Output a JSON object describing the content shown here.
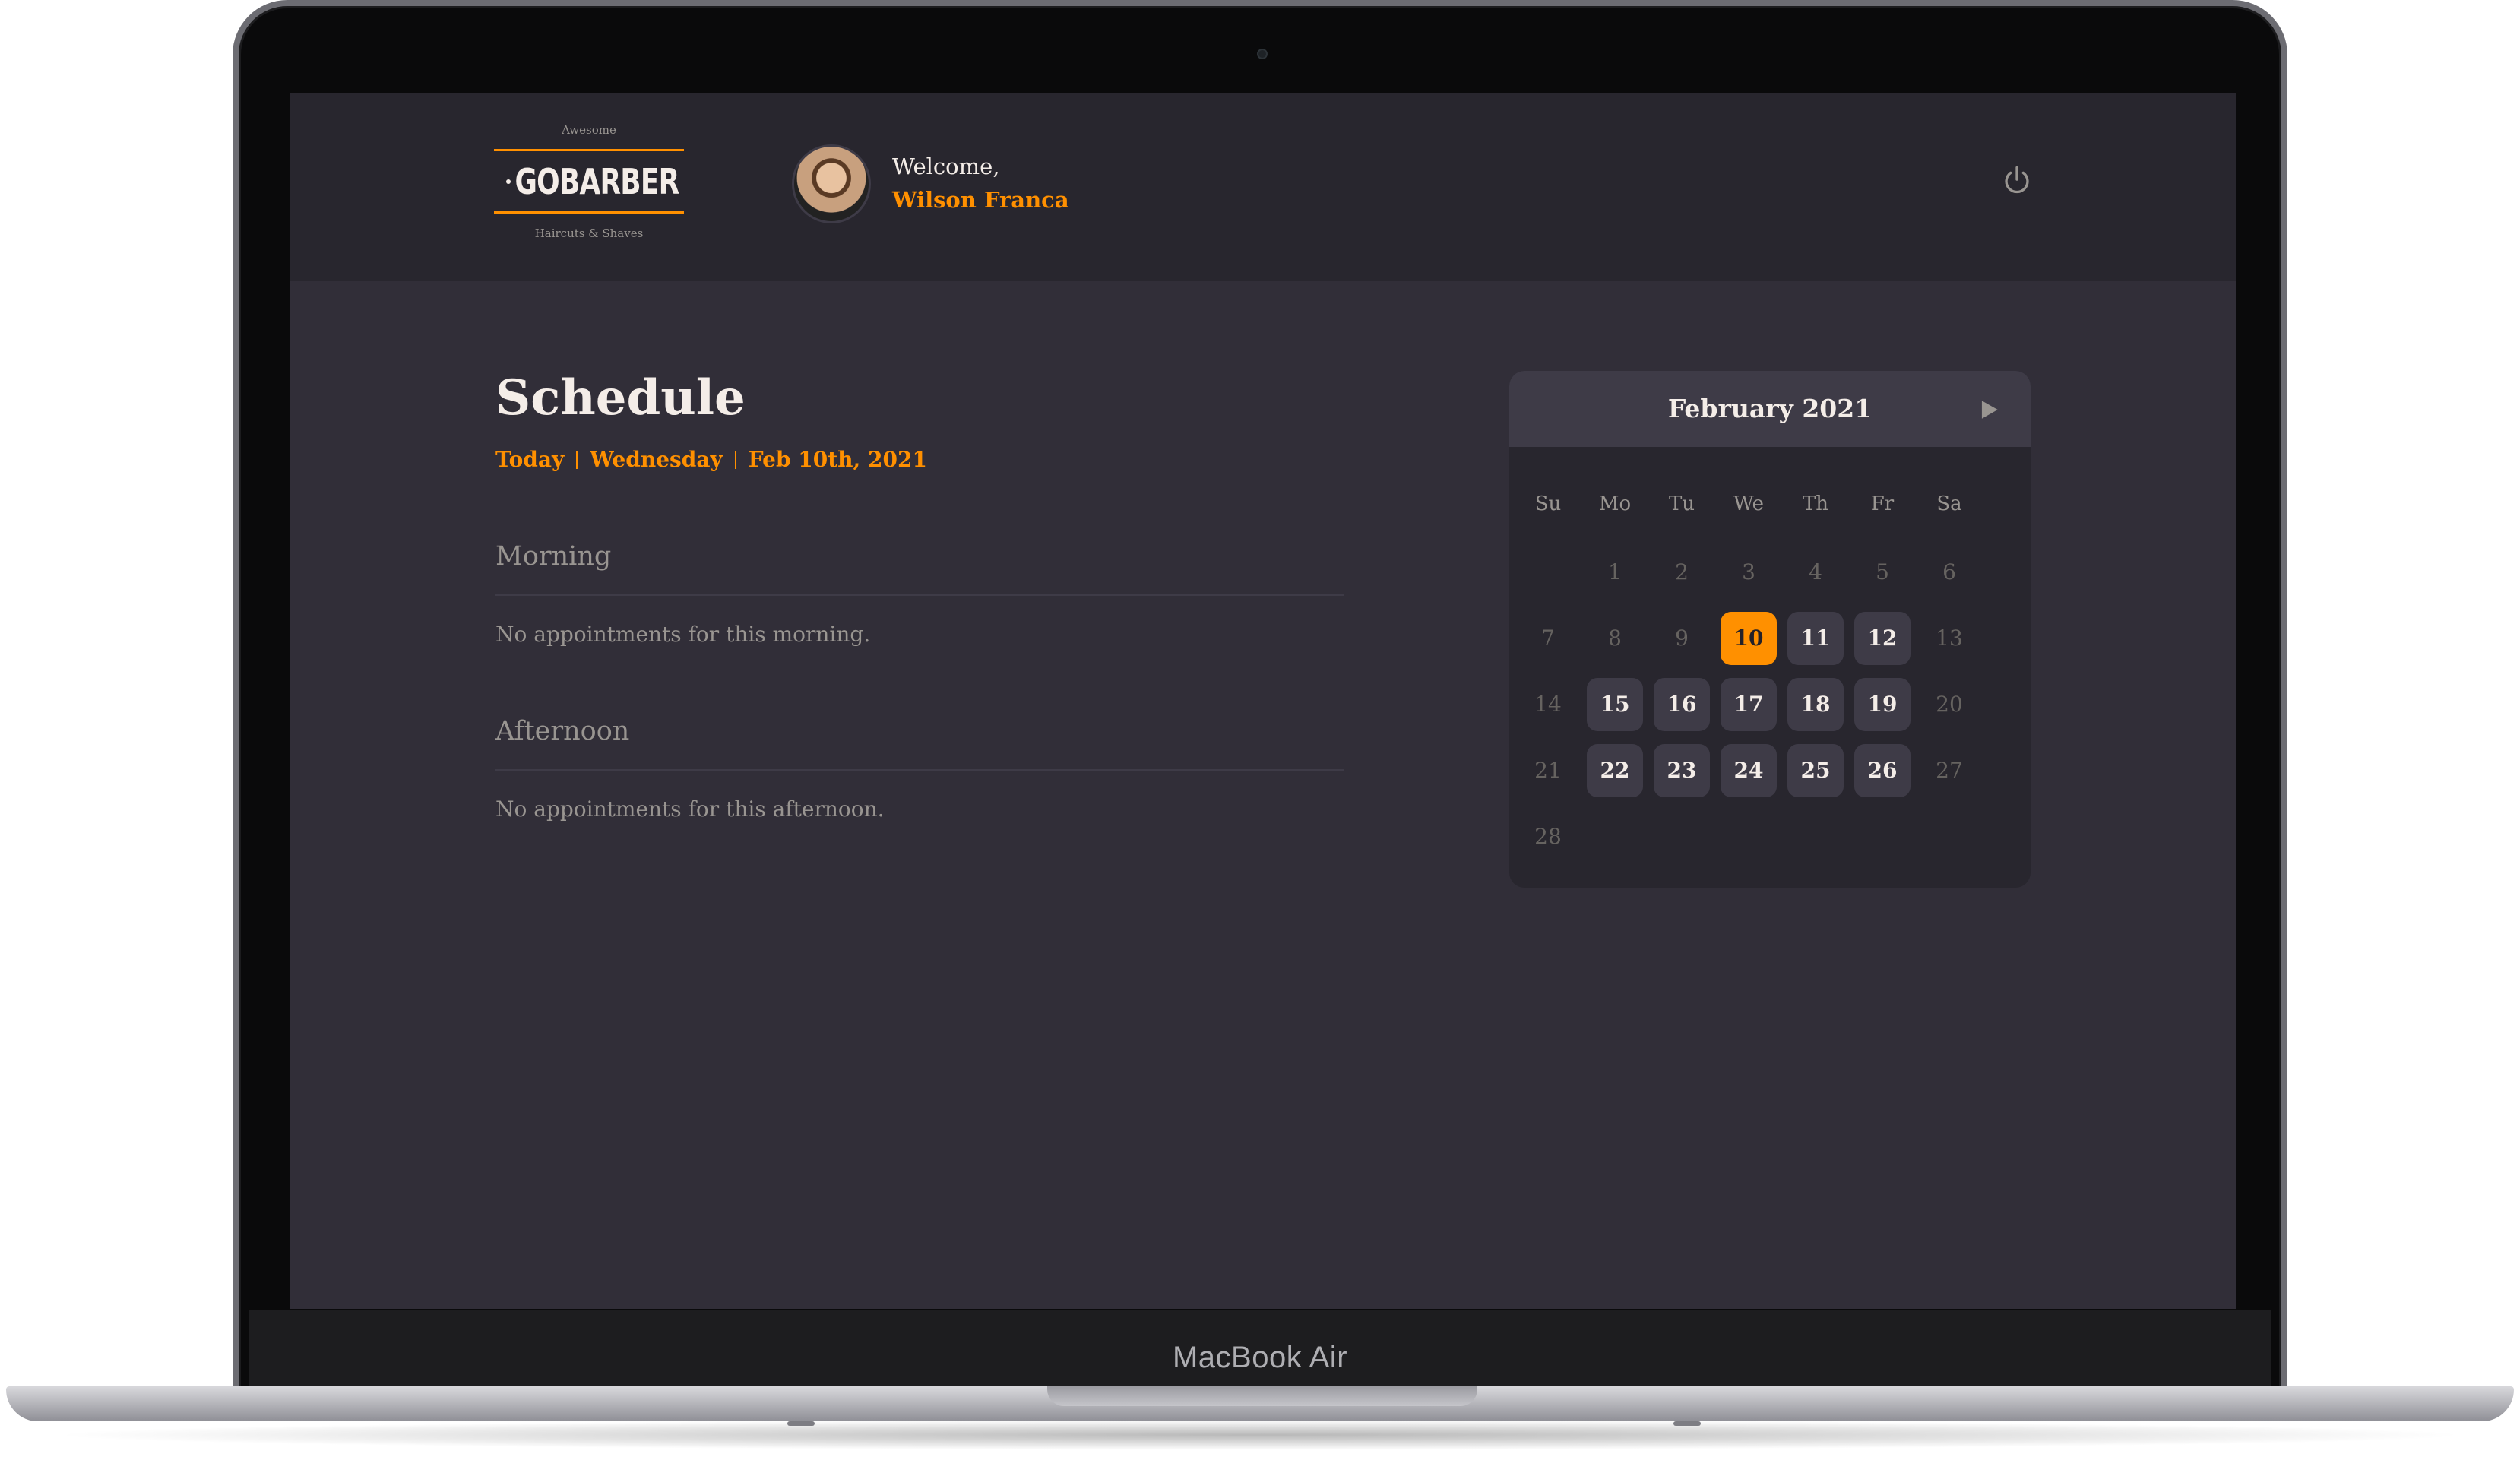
{
  "device": {
    "label": "MacBook Air"
  },
  "logo": {
    "top": "Awesome",
    "main": "GOBARBER",
    "bottom": "Haircuts & Shaves"
  },
  "header": {
    "welcome": "Welcome,",
    "user_name": "Wilson Franca",
    "avatar_icon": "user-avatar",
    "power_icon": "power-icon"
  },
  "schedule": {
    "title": "Schedule",
    "today": "Today",
    "weekday": "Wednesday",
    "date": "Feb 10th, 2021",
    "morning": {
      "title": "Morning",
      "empty": "No appointments for this morning."
    },
    "afternoon": {
      "title": "Afternoon",
      "empty": "No appointments for this afternoon."
    }
  },
  "calendar": {
    "month": "February 2021",
    "next_icon": "play-arrow-icon",
    "weekdays": [
      "Su",
      "Mo",
      "Tu",
      "We",
      "Th",
      "Fr",
      "Sa"
    ],
    "first_weekday_index": 1,
    "days_in_month": 28,
    "selected_day": 10,
    "enabled_days": [
      11,
      12,
      15,
      16,
      17,
      18,
      19,
      22,
      23,
      24,
      25,
      26
    ]
  },
  "colors": {
    "accent": "#ff9000",
    "background": "#312e38",
    "header": "#28262e",
    "text": "#f4ede8",
    "muted": "#999591"
  }
}
